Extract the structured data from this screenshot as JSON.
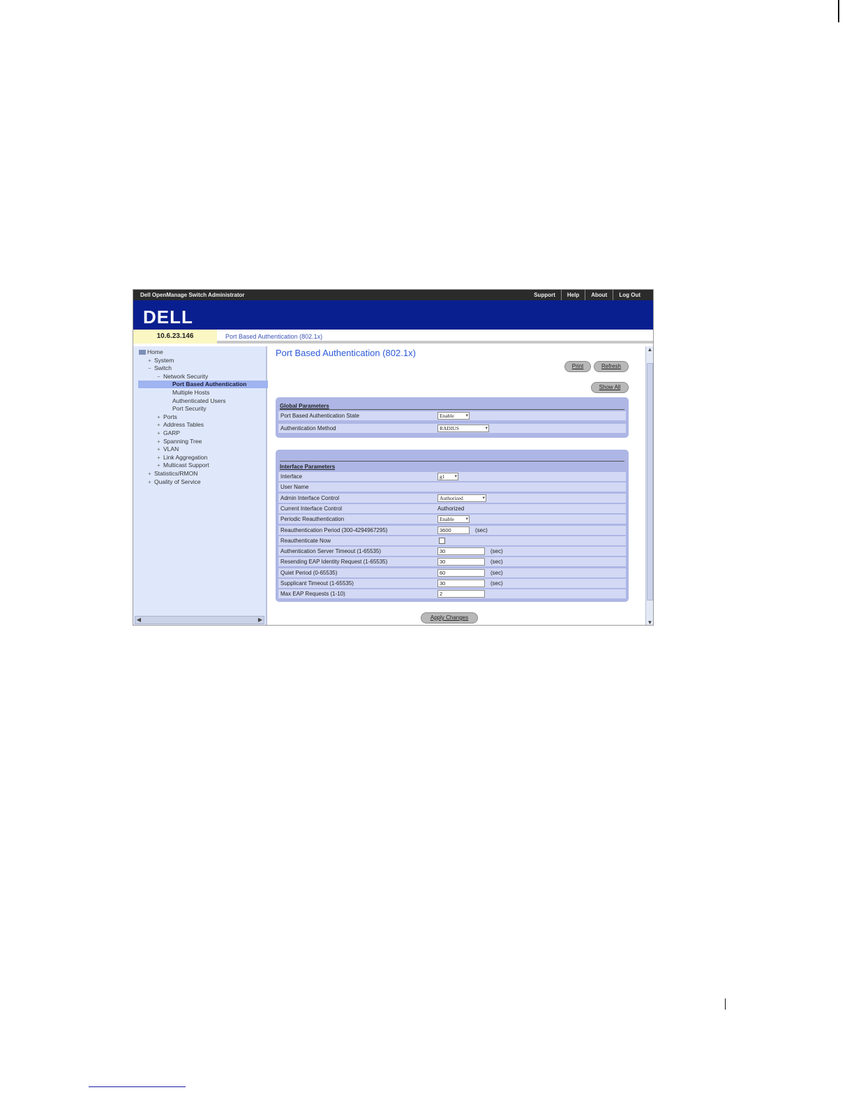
{
  "app": {
    "title": "Dell OpenManage Switch Administrator",
    "links": [
      "Support",
      "Help",
      "About",
      "Log Out"
    ],
    "logo": "DELL"
  },
  "address": {
    "ip": "10.6.23.146",
    "breadcrumb": "Port Based Authentication (802.1x)"
  },
  "tree": [
    {
      "label": "Home",
      "toggle": "",
      "active": false
    },
    {
      "label": "System",
      "toggle": "+",
      "active": false
    },
    {
      "label": "Switch",
      "toggle": "−",
      "active": false
    },
    {
      "label": "Network Security",
      "toggle": "−",
      "active": false
    },
    {
      "label": "Port Based Authentication",
      "toggle": "",
      "active": true
    },
    {
      "label": "Multiple Hosts",
      "toggle": "",
      "active": false
    },
    {
      "label": "Authenticated Users",
      "toggle": "",
      "active": false
    },
    {
      "label": "Port Security",
      "toggle": "",
      "active": false
    },
    {
      "label": "Ports",
      "toggle": "+",
      "active": false
    },
    {
      "label": "Address Tables",
      "toggle": "+",
      "active": false
    },
    {
      "label": "GARP",
      "toggle": "+",
      "active": false
    },
    {
      "label": "Spanning Tree",
      "toggle": "+",
      "active": false
    },
    {
      "label": "VLAN",
      "toggle": "+",
      "active": false
    },
    {
      "label": "Link Aggregation",
      "toggle": "+",
      "active": false
    },
    {
      "label": "Multicast Support",
      "toggle": "+",
      "active": false
    },
    {
      "label": "Statistics/RMON",
      "toggle": "+",
      "active": false
    },
    {
      "label": "Quality of Service",
      "toggle": "+",
      "active": false
    }
  ],
  "main": {
    "title": "Port Based Authentication (802.1x)",
    "buttons": {
      "print": "Print",
      "refresh": "Refresh",
      "show_all": "Show All",
      "apply": "Apply Changes"
    }
  },
  "global": {
    "title": "Global Parameters",
    "rows": [
      {
        "label": "Port Based Authentication State",
        "type": "select",
        "value": "Enable"
      },
      {
        "label": "Authentication Method",
        "type": "select",
        "value": "RADIUS"
      }
    ]
  },
  "interface": {
    "title": "Interface Parameters",
    "rows": [
      {
        "label": "Interface",
        "type": "select",
        "value": "g1"
      },
      {
        "label": "User Name",
        "type": "text",
        "value": ""
      },
      {
        "label": "Admin Interface Control",
        "type": "select",
        "value": "Authorized"
      },
      {
        "label": "Current Interface Control",
        "type": "text",
        "value": "Authorized"
      },
      {
        "label": "Periodic Reauthentication",
        "type": "select",
        "value": "Enable"
      },
      {
        "label": "Reauthentication Period (300-4294967295)",
        "type": "input",
        "value": "3600",
        "unit": "(sec)"
      },
      {
        "label": "Reauthenticate Now",
        "type": "checkbox",
        "value": ""
      },
      {
        "label": "Authentication Server Timeout (1-65535)",
        "type": "input",
        "value": "30",
        "unit": "(sec)"
      },
      {
        "label": "Resending EAP Identity Request (1-65535)",
        "type": "input",
        "value": "30",
        "unit": "(sec)"
      },
      {
        "label": "Quiet Period (0-65535)",
        "type": "input",
        "value": "60",
        "unit": "(sec)"
      },
      {
        "label": "Supplicant Timeout (1-65535)",
        "type": "input",
        "value": "30",
        "unit": "(sec)"
      },
      {
        "label": "Max EAP Requests (1-10)",
        "type": "input",
        "value": "2",
        "unit": ""
      }
    ]
  },
  "icons": {
    "dropdown": "chevron-down-icon",
    "scroll_up": "arrow-up-icon",
    "scroll_down": "arrow-down-icon",
    "scroll_left": "arrow-left-icon",
    "scroll_right": "arrow-right-icon",
    "home": "home-icon"
  },
  "colors": {
    "brand": "#0a1f8f",
    "sidebar": "#dfe8fb",
    "panel": "#aeb6e5",
    "title": "#2c5ad6",
    "ip_bg": "#fbf7c2"
  }
}
